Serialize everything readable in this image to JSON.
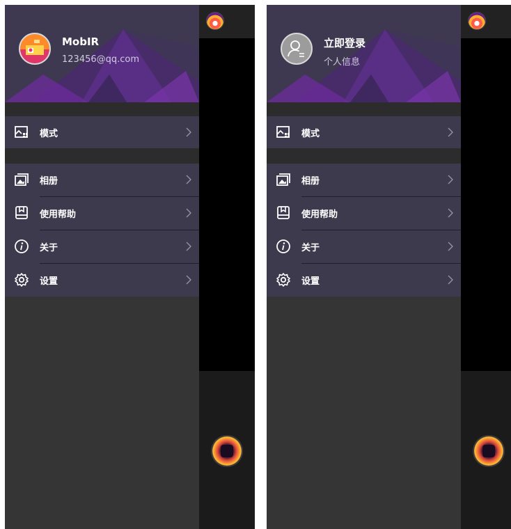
{
  "screens": [
    {
      "id": "logged-in",
      "user": {
        "name": "MobIR",
        "subtitle": "123456@qq.com"
      },
      "menu": {
        "mode": {
          "label": "模式",
          "icon": "image-mode-icon"
        },
        "items": [
          {
            "label": "相册",
            "icon": "album-icon"
          },
          {
            "label": "使用帮助",
            "icon": "help-book-icon"
          },
          {
            "label": "关于",
            "icon": "info-icon"
          },
          {
            "label": "设置",
            "icon": "gear-icon"
          }
        ]
      }
    },
    {
      "id": "logged-out",
      "user": {
        "name": "立即登录",
        "subtitle": "个人信息"
      },
      "menu": {
        "mode": {
          "label": "模式",
          "icon": "image-mode-icon"
        },
        "items": [
          {
            "label": "相册",
            "icon": "album-icon"
          },
          {
            "label": "使用帮助",
            "icon": "help-book-icon"
          },
          {
            "label": "关于",
            "icon": "info-icon"
          },
          {
            "label": "设置",
            "icon": "gear-icon"
          }
        ]
      }
    }
  ],
  "colors": {
    "drawer_background": "#353535",
    "header_background": "#3e3950",
    "header_accent": "#6a2c98",
    "menu_group_background": "#3e3a4e",
    "gap_background": "#2c2c2c",
    "text_primary": "#ffffff",
    "text_secondary": "#d0ccdf"
  }
}
